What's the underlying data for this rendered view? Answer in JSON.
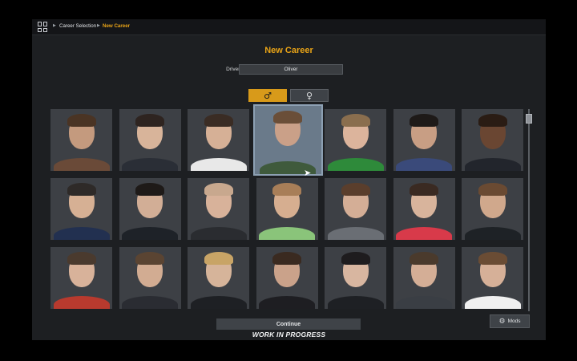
{
  "breadcrumb": {
    "items": [
      "Career Selection",
      "New Career"
    ],
    "menu_icon": "grid-icon"
  },
  "title": "New Career",
  "driver_name": {
    "label": "Driver's name",
    "value": "Oliver"
  },
  "gender": {
    "male_symbol": "♂",
    "female_symbol": "♀",
    "selected": "male"
  },
  "portraits": {
    "selected_index": 3,
    "items": [
      {
        "skin": "#c49a7e",
        "hair": "#4a3424",
        "shirt": "#6a4a38"
      },
      {
        "skin": "#d8b49a",
        "hair": "#2e2420",
        "shirt": "#2a2e36"
      },
      {
        "skin": "#d6b096",
        "hair": "#3a2c24",
        "shirt": "#e8e8e8"
      },
      {
        "skin": "#caa088",
        "hair": "#6a4e38",
        "shirt": "#3f5a3c"
      },
      {
        "skin": "#dcb49c",
        "hair": "#8a6e4e",
        "shirt": "#2e8a3a"
      },
      {
        "skin": "#c89e84",
        "hair": "#1e1a18",
        "shirt": "#3a4a7a"
      },
      {
        "skin": "#6a4632",
        "hair": "#2a1c14",
        "shirt": "#22252c"
      },
      {
        "skin": "#d6b094",
        "hair": "#2e2a28",
        "shirt": "#223050"
      },
      {
        "skin": "#d2ae96",
        "hair": "#1e1a18",
        "shirt": "#1e2228"
      },
      {
        "skin": "#d8b29a",
        "hair": "#c8a88e",
        "shirt": "#2a2c30"
      },
      {
        "skin": "#d6ae90",
        "hair": "#a87e58",
        "shirt": "#8ac47a"
      },
      {
        "skin": "#d4ae96",
        "hair": "#5a3e2c",
        "shirt": "#6a6e74"
      },
      {
        "skin": "#d8b49c",
        "hair": "#3a2a22",
        "shirt": "#d83a4a"
      },
      {
        "skin": "#d0a88c",
        "hair": "#6a4a32",
        "shirt": "#1e2226"
      },
      {
        "skin": "#d8b29a",
        "hair": "#4a3a2e",
        "shirt": "#b83a2e"
      },
      {
        "skin": "#d2ac92",
        "hair": "#5a4432",
        "shirt": "#2a2c32"
      },
      {
        "skin": "#d6b49a",
        "hair": "#c8a466",
        "shirt": "#1e2024"
      },
      {
        "skin": "#caa28a",
        "hair": "#3a2a20",
        "shirt": "#1e1e22"
      },
      {
        "skin": "#d8b6a0",
        "hair": "#1e1c1e",
        "shirt": "#1e2024"
      },
      {
        "skin": "#d4ae96",
        "hair": "#4a3a2c",
        "shirt": "#3a3e44"
      },
      {
        "skin": "#d6b098",
        "hair": "#6a4c34",
        "shirt": "#f0f0f0"
      }
    ]
  },
  "continue_label": "Continue",
  "footer_text": "WORK IN PROGRESS",
  "mods": {
    "label": "Mods",
    "icon": "mods-icon"
  },
  "colors": {
    "accent": "#e8a317",
    "panel": "#1d1f22",
    "tile": "#3d4045"
  }
}
